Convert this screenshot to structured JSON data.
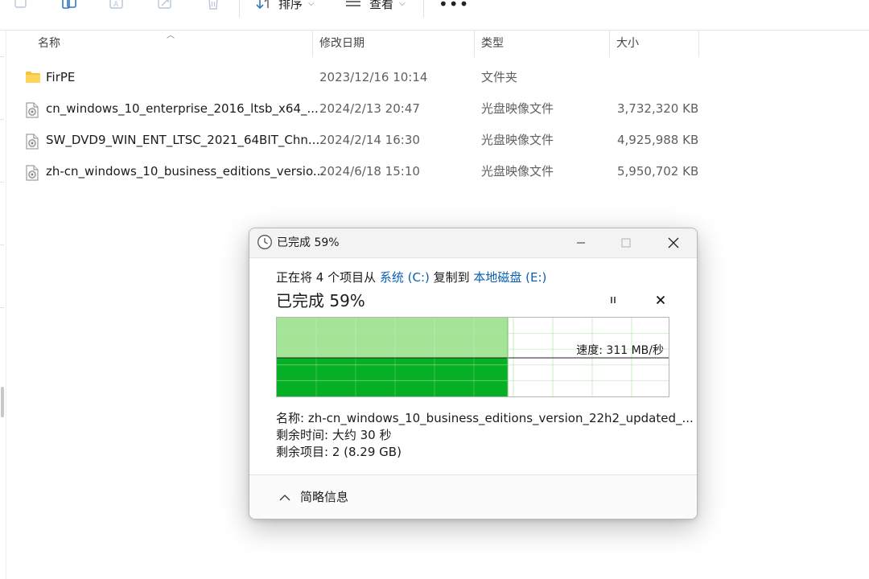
{
  "toolbar": {
    "icons": [
      "copy-icon",
      "copy-path-icon",
      "rename-icon",
      "share-icon",
      "delete-icon"
    ],
    "sort_label": "排序",
    "view_label": "查看",
    "more_label": "•••"
  },
  "columns": {
    "name": "名称",
    "date": "修改日期",
    "type": "类型",
    "size": "大小"
  },
  "files": [
    {
      "icon": "folder-icon",
      "name": "FirPE",
      "date": "2023/12/16 10:14",
      "type": "文件夹",
      "size": ""
    },
    {
      "icon": "disc-image-icon",
      "name": "cn_windows_10_enterprise_2016_ltsb_x64_...",
      "date": "2024/2/13 20:47",
      "type": "光盘映像文件",
      "size": "3,732,320 KB"
    },
    {
      "icon": "disc-image-icon",
      "name": "SW_DVD9_WIN_ENT_LTSC_2021_64BIT_Chn...",
      "date": "2024/2/14 16:30",
      "type": "光盘映像文件",
      "size": "4,925,988 KB"
    },
    {
      "icon": "disc-image-icon",
      "name": "zh-cn_windows_10_business_editions_versio...",
      "date": "2024/6/18 15:10",
      "type": "光盘映像文件",
      "size": "5,950,702 KB"
    }
  ],
  "dialog": {
    "title": "已完成 59%",
    "from_prefix": "正在将 4 个项目从 ",
    "source": "系统 (C:)",
    "middle": " 复制到 ",
    "dest": "本地磁盘 (E:)",
    "heading": "已完成 59%",
    "progress": 0.59,
    "speed_label": "速度: 311 MB/秒",
    "name_line": "名称:  zh-cn_windows_10_business_editions_version_22h2_updated_...",
    "time_line": "剩余时间:  大约 30 秒",
    "items_line": "剩余项目:  2 (8.29 GB)",
    "footer_label": "简略信息",
    "colors": {
      "progress_light": "#a4e497",
      "progress_dark": "#06b025",
      "link": "#0a5fb4"
    }
  }
}
